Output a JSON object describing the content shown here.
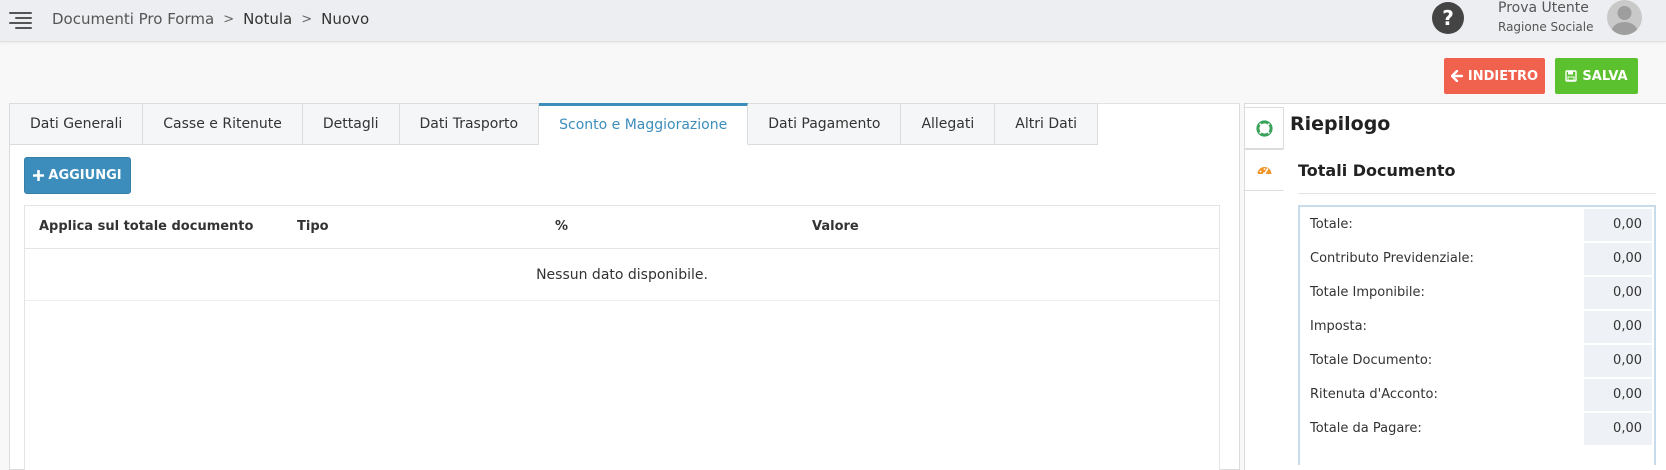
{
  "header": {
    "breadcrumb": [
      "Documenti Pro Forma",
      "Notula",
      "Nuovo"
    ],
    "breadcrumb_sep": ">",
    "help_label": "?",
    "user_name": "Prova Utente",
    "user_org": "Ragione Sociale"
  },
  "actions": {
    "back_label": "INDIETRO",
    "save_label": "SALVA"
  },
  "tabs": [
    {
      "label": "Dati Generali",
      "active": false
    },
    {
      "label": "Casse e Ritenute",
      "active": false
    },
    {
      "label": "Dettagli",
      "active": false
    },
    {
      "label": "Dati Trasporto",
      "active": false
    },
    {
      "label": "Sconto e Maggiorazione",
      "active": true
    },
    {
      "label": "Dati Pagamento",
      "active": false
    },
    {
      "label": "Allegati",
      "active": false
    },
    {
      "label": "Altri Dati",
      "active": false
    }
  ],
  "main": {
    "add_label": "AGGIUNGI",
    "columns": [
      "Applica sul totale documento",
      "Tipo",
      "%",
      "Valore"
    ],
    "empty_message": "Nessun dato disponibile."
  },
  "summary": {
    "title": "Riepilogo",
    "section_title": "Totali Documento",
    "rows": [
      {
        "label": "Totale:",
        "value": "0,00"
      },
      {
        "label": "Contributo Previdenziale:",
        "value": "0,00"
      },
      {
        "label": "Totale Imponibile:",
        "value": "0,00"
      },
      {
        "label": "Imposta:",
        "value": "0,00"
      },
      {
        "label": "Totale Documento:",
        "value": "0,00"
      },
      {
        "label": "Ritenuta d'Acconto:",
        "value": "0,00"
      },
      {
        "label": "Totale da Pagare:",
        "value": "0,00"
      }
    ]
  },
  "colors": {
    "accent": "#3c8dbc",
    "danger": "#f0624d",
    "success": "#5cc12f",
    "lifebuoy": "#3aa35a",
    "palette": "#f0952a"
  },
  "icons": {
    "menu": "menu-lines-icon",
    "help": "question-icon",
    "user": "avatar-icon",
    "back": "arrow-left-icon",
    "save": "floppy-disk-icon",
    "add": "plus-icon",
    "side_tab_1": "lifebuoy-icon",
    "side_tab_2": "dashboard-gauge-icon"
  }
}
